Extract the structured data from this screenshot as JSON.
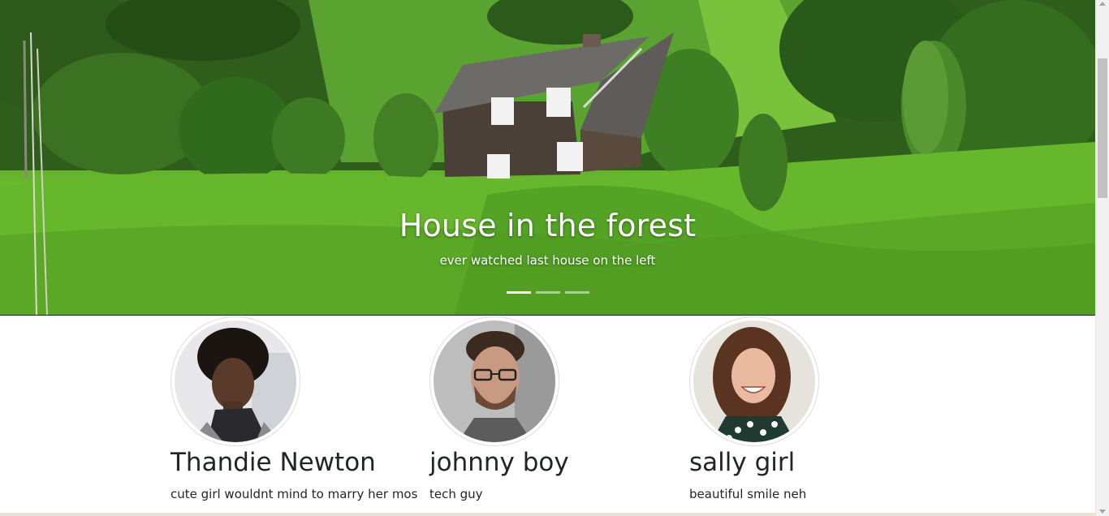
{
  "carousel": {
    "title": "House in the forest",
    "subtitle": "ever watched last house on the left",
    "indicators": [
      {
        "active": true
      },
      {
        "active": false
      },
      {
        "active": false
      }
    ]
  },
  "profiles": [
    {
      "name": "Thandie Newton",
      "text": "cute girl wouldnt mind to marry her mos"
    },
    {
      "name": "johnny boy",
      "text": "tech guy"
    },
    {
      "name": "sally girl",
      "text": "beautiful smile neh"
    }
  ]
}
